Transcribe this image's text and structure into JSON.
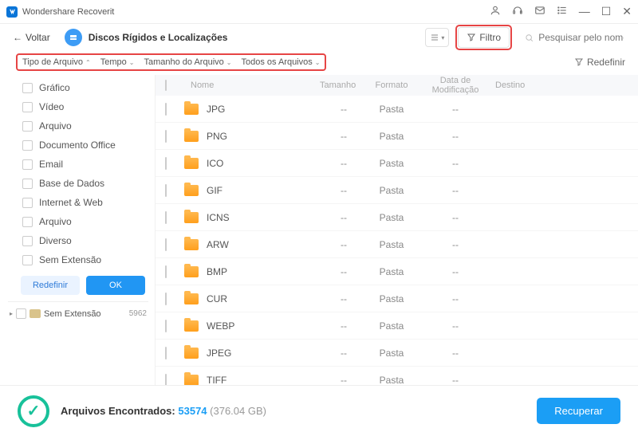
{
  "app": {
    "title": "Wondershare Recoverit"
  },
  "toolbar": {
    "back": "Voltar",
    "breadcrumb": "Discos Rígidos e Localizações",
    "filter": "Filtro",
    "search_placeholder": "Pesquisar pelo nome ou lo..."
  },
  "filters": {
    "type": "Tipo de Arquivo",
    "time": "Tempo",
    "size": "Tamanho do Arquivo",
    "all": "Todos os Arquivos",
    "reset": "Redefinir"
  },
  "sidebar": {
    "items": [
      "Gráfico",
      "Vídeo",
      "Arquivo",
      "Documento Office",
      "Email",
      "Base de Dados",
      "Internet & Web",
      "Arquivo",
      "Diverso",
      "Sem Extensão"
    ],
    "reset": "Redefinir",
    "ok": "OK",
    "tree": {
      "label": "Sem Extensão",
      "count": "5962"
    }
  },
  "table": {
    "headers": {
      "name": "Nome",
      "size": "Tamanho",
      "format": "Formato",
      "modified": "Data de Modificação",
      "dest": "Destino"
    },
    "rows": [
      {
        "name": "JPG",
        "size": "--",
        "format": "Pasta",
        "modified": "--"
      },
      {
        "name": "PNG",
        "size": "--",
        "format": "Pasta",
        "modified": "--"
      },
      {
        "name": "ICO",
        "size": "--",
        "format": "Pasta",
        "modified": "--"
      },
      {
        "name": "GIF",
        "size": "--",
        "format": "Pasta",
        "modified": "--"
      },
      {
        "name": "ICNS",
        "size": "--",
        "format": "Pasta",
        "modified": "--"
      },
      {
        "name": "ARW",
        "size": "--",
        "format": "Pasta",
        "modified": "--"
      },
      {
        "name": "BMP",
        "size": "--",
        "format": "Pasta",
        "modified": "--"
      },
      {
        "name": "CUR",
        "size": "--",
        "format": "Pasta",
        "modified": "--"
      },
      {
        "name": "WEBP",
        "size": "--",
        "format": "Pasta",
        "modified": "--"
      },
      {
        "name": "JPEG",
        "size": "--",
        "format": "Pasta",
        "modified": "--"
      },
      {
        "name": "TIFF",
        "size": "--",
        "format": "Pasta",
        "modified": "--"
      }
    ]
  },
  "footer": {
    "label": "Arquivos Encontrados:",
    "count": "53574",
    "size": "(376.04 GB)",
    "recover": "Recuperar"
  }
}
